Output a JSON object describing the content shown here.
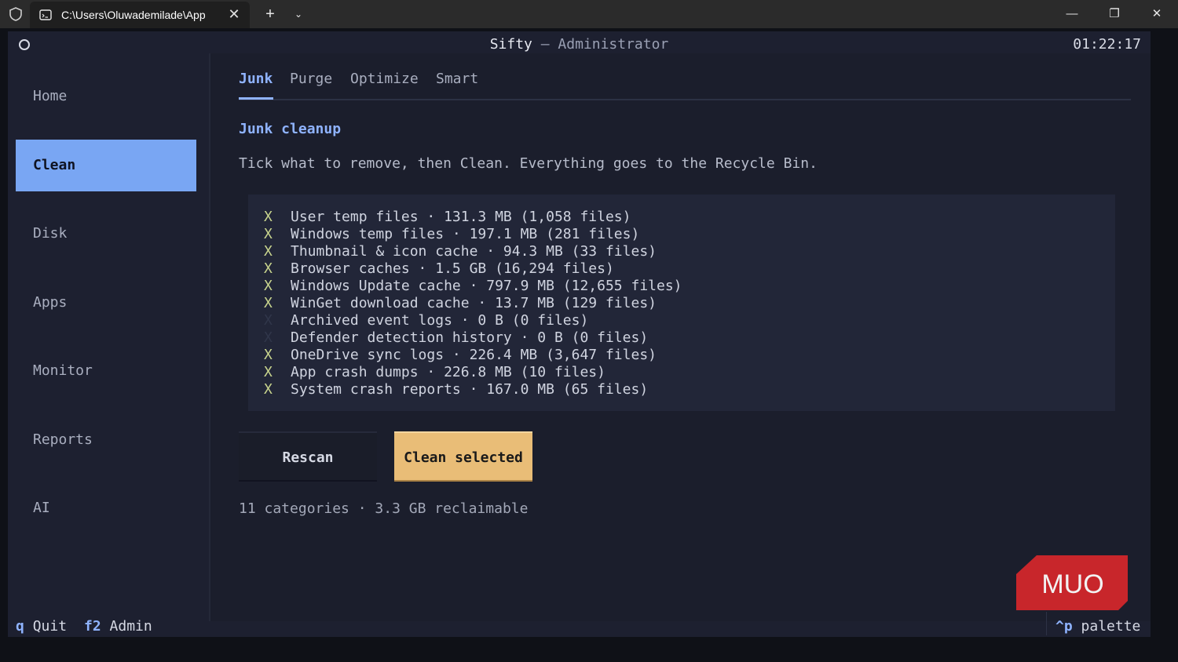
{
  "window": {
    "tab_title": "C:\\Users\\Oluwademilade\\App",
    "close_tab": "✕",
    "new_tab": "+",
    "dropdown": "⌄",
    "minimize": "—",
    "maximize": "❐",
    "close_window": "✕"
  },
  "app": {
    "title_name": "Sifty",
    "title_suffix": " – Administrator",
    "clock": "01:22:17"
  },
  "sidebar": {
    "items": [
      {
        "label": "Home"
      },
      {
        "label": "Clean"
      },
      {
        "label": "Disk"
      },
      {
        "label": "Apps"
      },
      {
        "label": "Monitor"
      },
      {
        "label": "Reports"
      },
      {
        "label": "AI"
      }
    ],
    "active": "Clean"
  },
  "tabs": [
    {
      "label": "Junk"
    },
    {
      "label": "Purge"
    },
    {
      "label": "Optimize"
    },
    {
      "label": "Smart"
    }
  ],
  "active_tab": "Junk",
  "section_title": "Junk cleanup",
  "description": "Tick what to remove, then Clean. Everything goes to the Recycle Bin.",
  "items": [
    {
      "mark": "X",
      "checked": true,
      "text": "User temp files  ·  131.3 MB  (1,058 files)"
    },
    {
      "mark": "X",
      "checked": true,
      "text": "Windows temp files  ·  197.1 MB  (281 files)"
    },
    {
      "mark": "X",
      "checked": true,
      "text": "Thumbnail & icon cache  ·  94.3 MB  (33 files)"
    },
    {
      "mark": "X",
      "checked": true,
      "text": "Browser caches  ·  1.5 GB  (16,294 files)"
    },
    {
      "mark": "X",
      "checked": true,
      "text": "Windows Update cache  ·  797.9 MB  (12,655 files)"
    },
    {
      "mark": "X",
      "checked": true,
      "text": "WinGet download cache  ·  13.7 MB  (129 files)"
    },
    {
      "mark": "X",
      "checked": false,
      "text": "Archived event logs  ·  0 B  (0 files)"
    },
    {
      "mark": "X",
      "checked": false,
      "text": "Defender detection history  ·  0 B  (0 files)"
    },
    {
      "mark": "X",
      "checked": true,
      "text": "OneDrive sync logs  ·  226.4 MB  (3,647 files)"
    },
    {
      "mark": "X",
      "checked": true,
      "text": "App crash dumps  ·  226.8 MB  (10 files)"
    },
    {
      "mark": "X",
      "checked": true,
      "text": "System crash reports  ·  167.0 MB  (65 files)"
    }
  ],
  "buttons": {
    "rescan": "Rescan",
    "clean_selected": "Clean selected"
  },
  "summary": "11 categories · 3.3 GB reclaimable",
  "footer": {
    "quit_key": "q",
    "quit_label": "Quit",
    "admin_key": "f2",
    "admin_label": "Admin",
    "palette_key": "^p",
    "palette_label": "palette"
  },
  "logo_text": "MUO",
  "colors": {
    "accent": "#8fb3ff",
    "active_nav": "#79a6f3",
    "primary_button": "#e9bd77",
    "check_mark": "#c8d48e",
    "logo": "#c8262b"
  }
}
